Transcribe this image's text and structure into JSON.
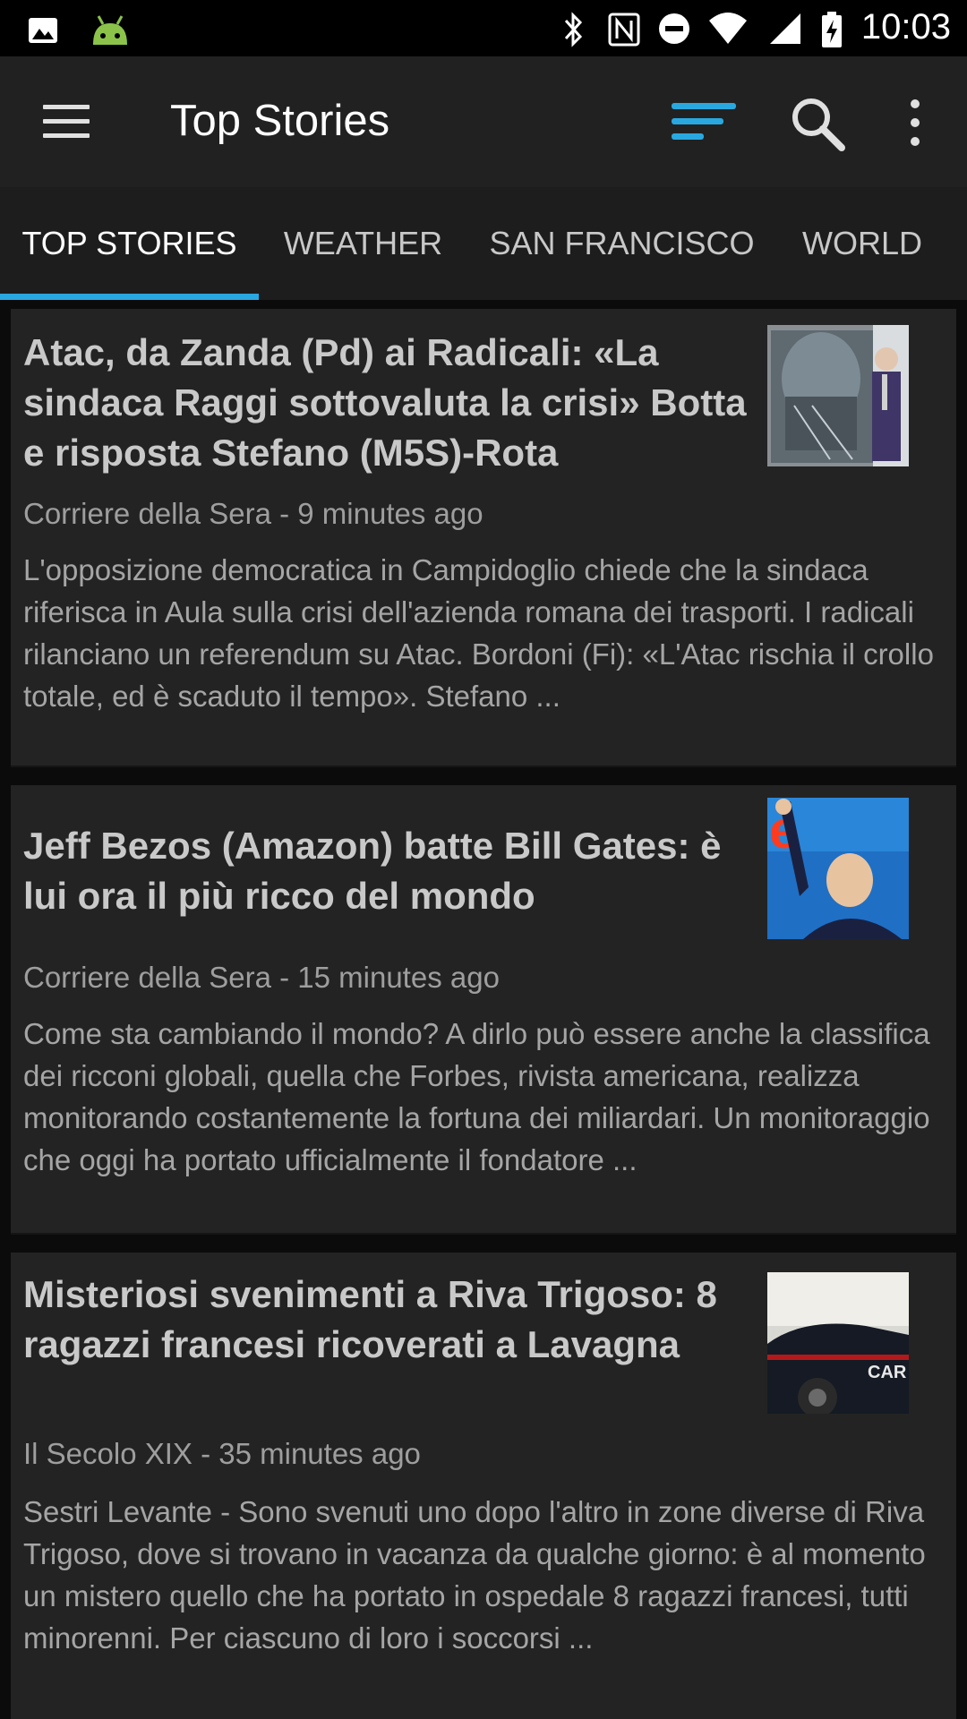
{
  "status_bar": {
    "time": "10:03",
    "icons": [
      "image-icon",
      "android-icon",
      "bluetooth-icon",
      "nfc-icon",
      "do-not-disturb-icon",
      "wifi-icon",
      "signal-icon",
      "battery-charging-icon"
    ]
  },
  "toolbar": {
    "title": "Top Stories",
    "accent_color": "#29a8e0",
    "icons": [
      "menu-icon",
      "sort-icon",
      "search-icon",
      "more-vert-icon"
    ]
  },
  "tabs": [
    {
      "label": "TOP STORIES",
      "active": true
    },
    {
      "label": "WEATHER",
      "active": false
    },
    {
      "label": "SAN FRANCISCO",
      "active": false
    },
    {
      "label": "WORLD",
      "active": false
    }
  ],
  "articles": [
    {
      "title": "Atac, da Zanda (Pd) ai Radicali: «La sindaca Raggi sottovaluta la crisi» Botta e risposta Stefano (M5S)-Rota",
      "source": "Corriere della Sera - 9 minutes ago",
      "snippet": "L'opposizione democratica in Campidoglio chiede che la sindaca riferisca in Aula sulla crisi dell'azienda romana dei trasporti. I radicali rilanciano un referendum su Atac. Bordoni (Fi): «L'Atac rischia il crollo totale, ed è scaduto il tempo». Stefano ..."
    },
    {
      "title": "Jeff Bezos (Amazon) batte Bill Gates: è lui ora il più ricco del mondo",
      "source": "Corriere della Sera - 15 minutes ago",
      "snippet": "Come sta cambiando il mondo? A dirlo può essere anche la classifica dei ricconi globali, quella che Forbes, rivista americana, realizza monitorando costantemente la fortuna dei miliardari. Un monitoraggio che oggi ha portato ufficialmente il fondatore ..."
    },
    {
      "title": "Misteriosi svenimenti a Riva Trigoso: 8 ragazzi francesi ricoverati a Lavagna",
      "source": "Il Secolo XIX - 35 minutes ago",
      "snippet": "Sestri Levante - Sono svenuti uno dopo l'altro in zone diverse di Riva Trigoso, dove si trovano in vacanza da qualche giorno: è al momento un mistero quello che ha portato in ospedale 8 ragazzi francesi, tutti minorenni. Per ciascuno di loro i soccorsi ..."
    }
  ]
}
